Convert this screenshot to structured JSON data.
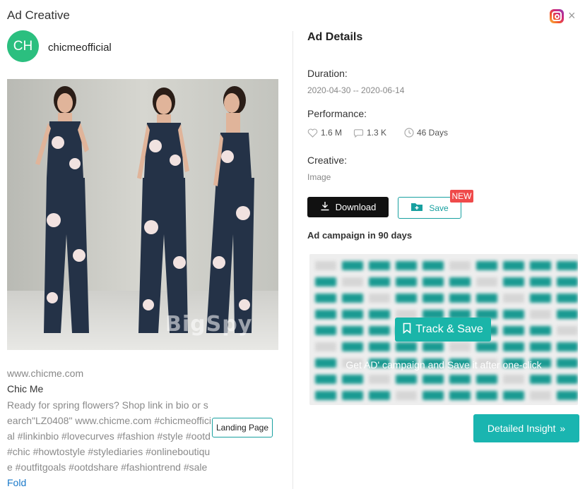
{
  "modal": {
    "title": "Ad Creative"
  },
  "icons": {
    "platform": "instagram-icon",
    "close": "close-icon"
  },
  "advertiser": {
    "initials": "CH",
    "name": "chicmeofficial",
    "avatar_color": "#2bbf7f"
  },
  "creative": {
    "watermark": "BigSpy",
    "domain": "www.chicme.com",
    "brand": "Chic Me",
    "description": "Ready for spring flowers? Shop link in bio or search\"LZ0408\" www.chicme.com #chicmeofficial #linkinbio #lovecurves #fashion #style #ootd #chic #howtostyle #stylediaries #onlineboutique #outfitgoals #ootdshare #fashiontrend #sale",
    "fold_label": "Fold",
    "landing_page_label": "Landing Page"
  },
  "details": {
    "heading": "Ad Details",
    "duration_label": "Duration:",
    "duration_value": "2020-04-30 -- 2020-06-14",
    "performance_label": "Performance:",
    "likes": "1.6 M",
    "comments": "1.3 K",
    "days": "46 Days",
    "creative_label": "Creative:",
    "creative_value": "Image",
    "download_label": "Download",
    "save_label": "Save",
    "new_badge": "NEW"
  },
  "campaign": {
    "title": "Ad campaign in 90 days",
    "track_label": "Track & Save",
    "note": "Get AD' campaign and Save it after one-click"
  },
  "insight": {
    "label": "Detailed Insight"
  },
  "colors": {
    "accent": "#1ab5b0",
    "badge": "#ef4a4a",
    "link": "#1a79c9"
  }
}
